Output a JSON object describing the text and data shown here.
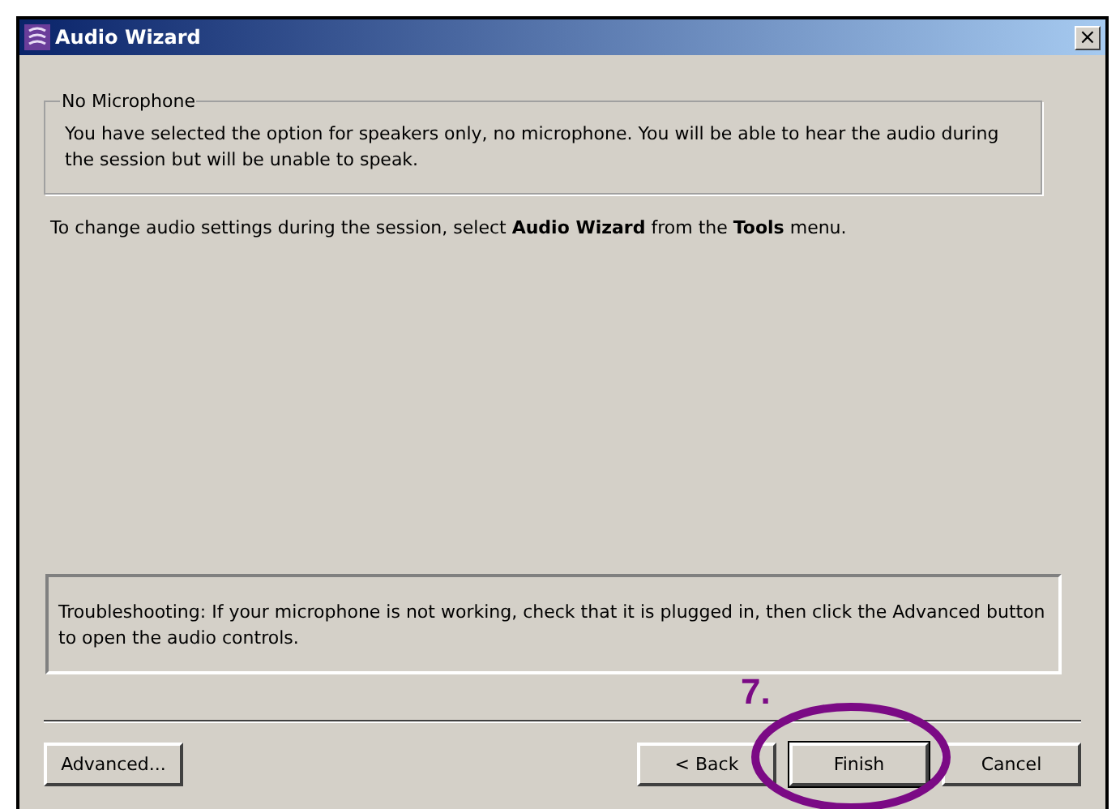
{
  "window": {
    "title": "Audio Wizard",
    "close": "×"
  },
  "group": {
    "legend": "No Microphone",
    "text": "You have selected the option for speakers only, no microphone. You will be able to hear the audio during the session but will be unable to speak."
  },
  "instruction": "To change audio settings during the session, select **Audio Wizard** from the **Tools** menu.",
  "troubleshooting": "Troubleshooting: If your microphone is not working, check that it is plugged in, then click the Advanced button to open the audio controls.",
  "buttons": [
    {
      "label": "Advanced...",
      "kind": "left",
      "selected": false
    },
    {
      "label": "< Back",
      "kind": "right",
      "selected": false
    },
    {
      "label": "Finish",
      "kind": "right",
      "selected": true
    },
    {
      "label": "Cancel",
      "kind": "right",
      "selected": false
    }
  ],
  "annotation": {
    "label": "7."
  }
}
